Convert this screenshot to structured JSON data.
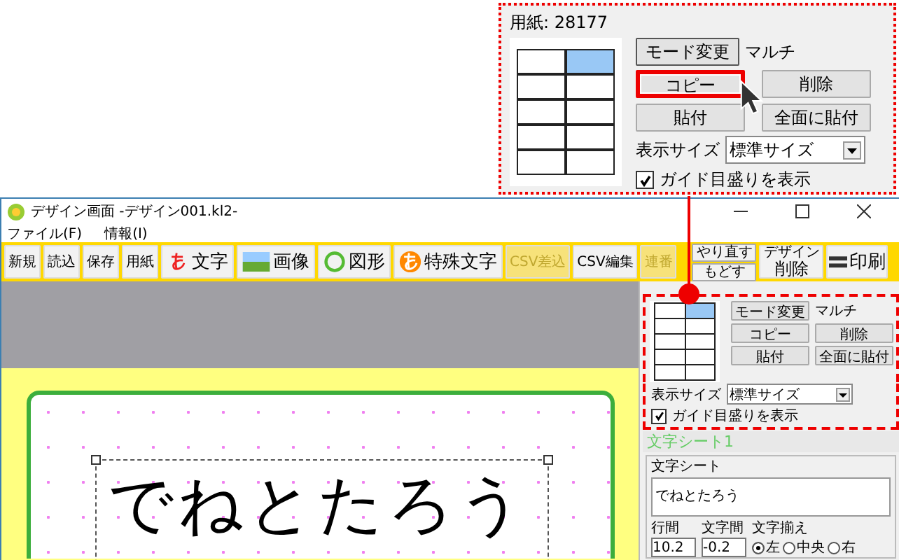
{
  "callout": {
    "paper_label": "用紙: 28177",
    "cells": [
      {
        "selected": false
      },
      {
        "selected": true
      },
      {
        "selected": false
      },
      {
        "selected": false
      },
      {
        "selected": false
      },
      {
        "selected": false
      },
      {
        "selected": false
      },
      {
        "selected": false
      },
      {
        "selected": false
      },
      {
        "selected": false
      }
    ],
    "mode_button": "モード変更",
    "mode_value": "マルチ",
    "buttons": [
      {
        "label": "コピー",
        "highlighted": true
      },
      {
        "label": "削除",
        "highlighted": false
      },
      {
        "label": "貼付",
        "highlighted": false
      },
      {
        "label": "全面に貼付",
        "highlighted": false
      }
    ],
    "size_label": "表示サイズ",
    "size_value": "標準サイズ",
    "guide": {
      "label": "ガイド目盛りを表示",
      "checked": true
    }
  },
  "window": {
    "title": "デザイン画面 -デザイン001.kl2-",
    "menu": [
      "ファイル(F)",
      "情報(I)"
    ]
  },
  "toolbar": [
    {
      "kind": "small",
      "label": "新規",
      "disabled": false
    },
    {
      "kind": "small",
      "label": "読込",
      "disabled": false
    },
    {
      "kind": "small",
      "label": "保存",
      "disabled": false
    },
    {
      "kind": "small",
      "label": "用紙",
      "disabled": false
    },
    {
      "kind": "hiragana",
      "label": "文字",
      "disabled": false
    },
    {
      "kind": "landscape",
      "label": "画像",
      "disabled": false
    },
    {
      "kind": "circle",
      "label": "図形",
      "disabled": false
    },
    {
      "kind": "badge",
      "label": "特殊文字",
      "disabled": false
    },
    {
      "kind": "small",
      "label": "CSV差込",
      "disabled": true
    },
    {
      "kind": "small",
      "label": "CSV編集",
      "disabled": false
    },
    {
      "kind": "small",
      "label": "連番",
      "disabled": true
    },
    {
      "kind": "stack",
      "labels": [
        {
          "label": "やり直す",
          "disabled": false
        },
        {
          "label": "もどす",
          "disabled": false
        }
      ]
    },
    {
      "kind": "caption",
      "caption": "デザイン",
      "label": "削除",
      "disabled": false
    },
    {
      "kind": "printer",
      "label": "印刷",
      "disabled": false
    }
  ],
  "canvas": {
    "text": "でねとたろう"
  },
  "panel": {
    "cells": [
      {
        "selected": false
      },
      {
        "selected": true
      },
      {
        "selected": false
      },
      {
        "selected": false
      },
      {
        "selected": false
      },
      {
        "selected": false
      },
      {
        "selected": false
      },
      {
        "selected": false
      },
      {
        "selected": false
      },
      {
        "selected": false
      }
    ],
    "mode_button": "モード変更",
    "mode_value": "マルチ",
    "buttons": [
      {
        "label": "コピー"
      },
      {
        "label": "削除"
      },
      {
        "label": "貼付"
      },
      {
        "label": "全面に貼付"
      }
    ],
    "size_label": "表示サイズ",
    "size_value": "標準サイズ",
    "guide": {
      "label": "ガイド目盛りを表示",
      "checked": true
    },
    "sheet_title": "文字シート1",
    "group_label": "文字シート",
    "sheet_text": "でねとたろう",
    "spins": [
      {
        "label": "行間",
        "value": "10.2"
      },
      {
        "label": "文字間",
        "value": "-0.2"
      }
    ],
    "align": {
      "label": "文字揃え",
      "options": [
        {
          "label": "左",
          "selected": true
        },
        {
          "label": "中央",
          "selected": false
        },
        {
          "label": "右",
          "selected": false
        }
      ]
    }
  }
}
